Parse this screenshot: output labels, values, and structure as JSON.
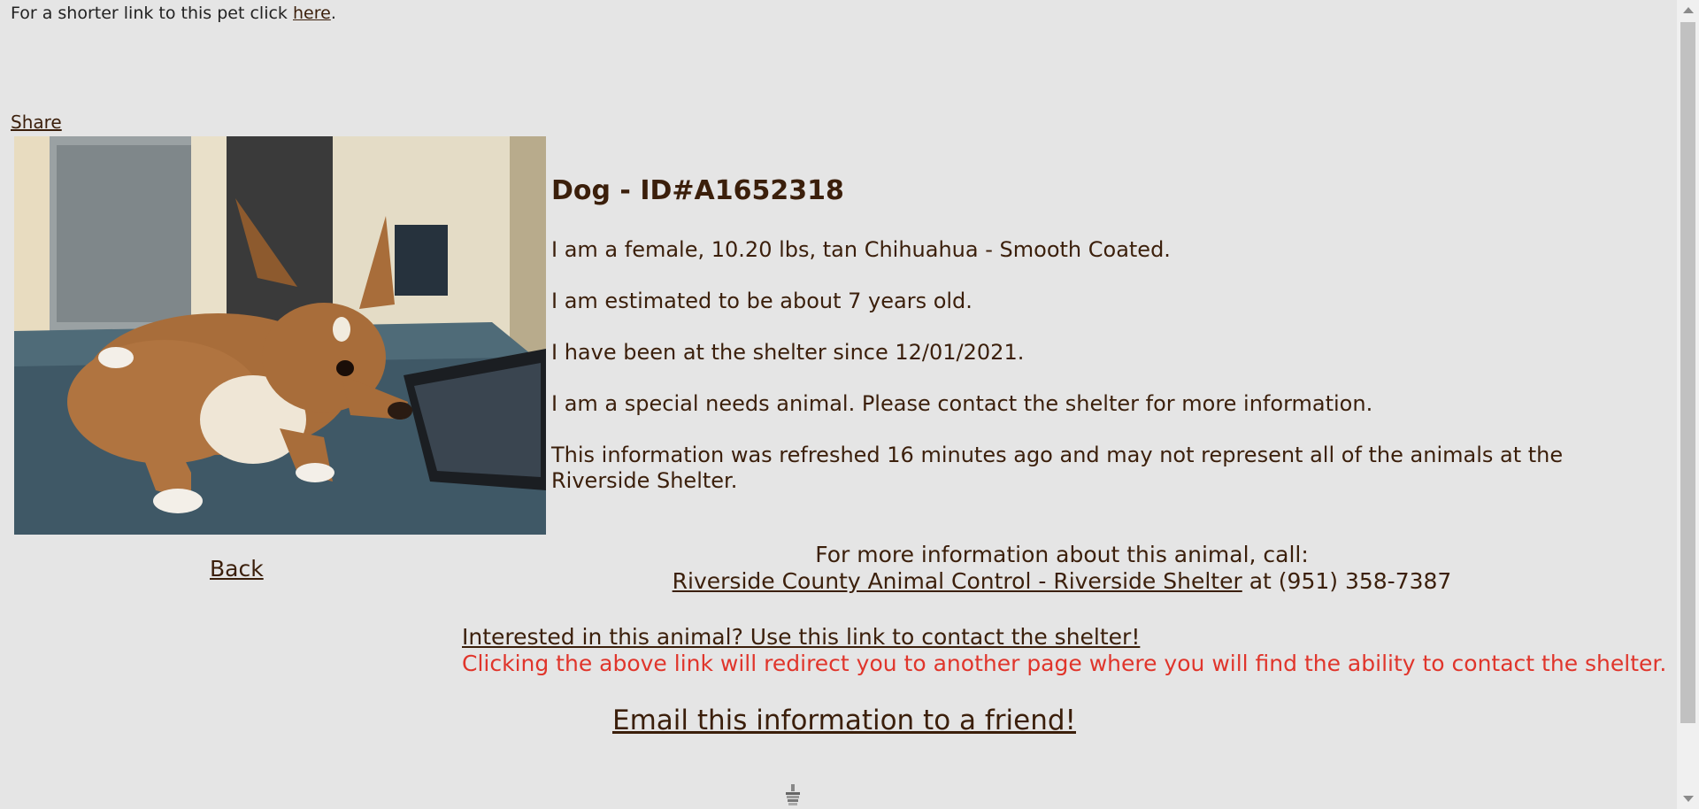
{
  "top_line": {
    "prefix": "For a shorter link to this pet click ",
    "link_text": "here",
    "suffix": "."
  },
  "share_label": "Share",
  "back_label": "Back",
  "pet": {
    "heading": "Dog - ID#A1652318",
    "paragraphs": [
      "I am a female, 10.20 lbs, tan Chihuahua - Smooth Coated.",
      "I am estimated to be about 7 years old.",
      "I have been at the shelter since 12/01/2021.",
      "I am a special needs animal. Please contact the shelter for more information.",
      "This information was refreshed 16 minutes ago and may not represent all of the animals at the Riverside Shelter."
    ]
  },
  "call": {
    "line1": "For more information about this animal, call:",
    "shelter_link": "Riverside County Animal Control - Riverside Shelter",
    "at_phone": " at (951) 358-7387"
  },
  "contact": {
    "link_text": "Interested in this animal? Use this link to contact the shelter!",
    "warning": "Clicking the above link will redirect you to another page where you will find the ability to contact the shelter."
  },
  "email_label": "Email this information to a friend!",
  "colors": {
    "background": "#e5e5e5",
    "text": "#3b1f0b",
    "warning": "#e0352b"
  },
  "icons": {
    "loading": "loading-spinner-icon"
  }
}
